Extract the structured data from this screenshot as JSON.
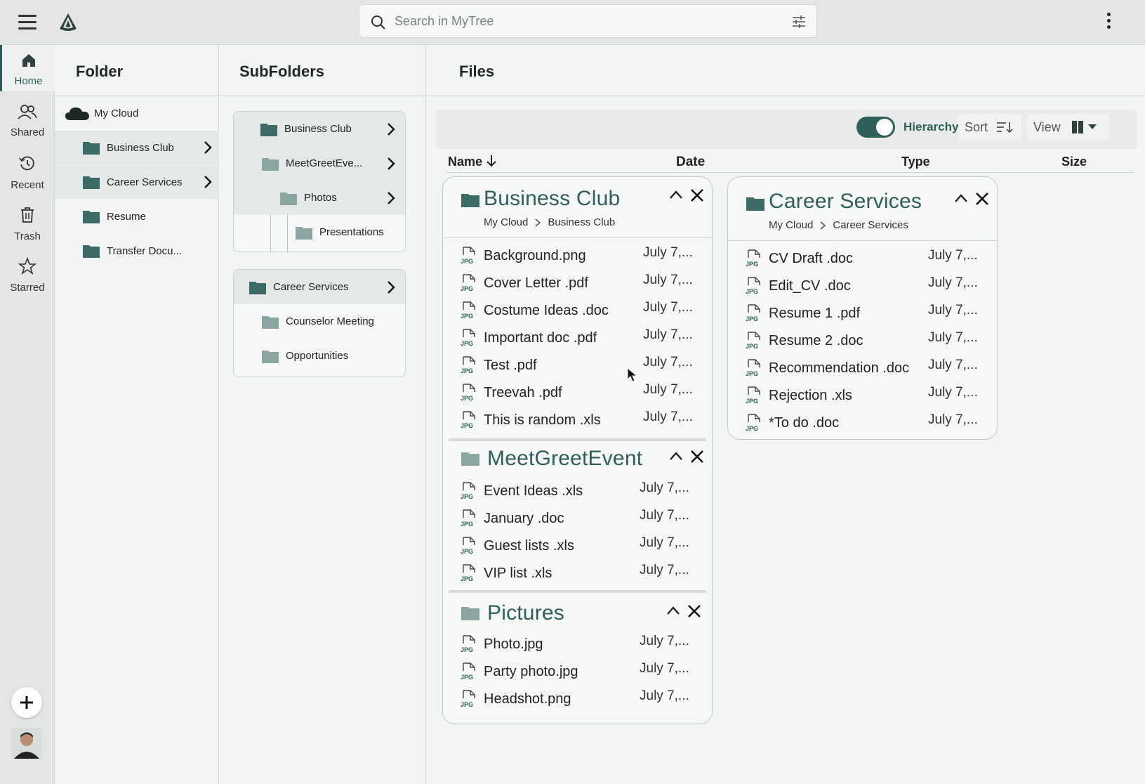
{
  "search": {
    "placeholder": "Search in MyTree"
  },
  "nav": {
    "items": [
      {
        "label": "Home",
        "icon": "home-icon"
      },
      {
        "label": "Shared",
        "icon": "shared-icon"
      },
      {
        "label": "Recent",
        "icon": "recent-icon"
      },
      {
        "label": "Trash",
        "icon": "trash-icon"
      },
      {
        "label": "Starred",
        "icon": "star-icon"
      }
    ]
  },
  "folder_col": {
    "title": "Folder",
    "root": "My Cloud",
    "items": [
      "Business Club",
      "Career Services",
      "Resume",
      "Transfer Docu..."
    ]
  },
  "sub_col": {
    "title": "SubFolders",
    "card1": [
      "Business Club",
      "MeetGreetEve...",
      "Photos",
      "Presentations"
    ],
    "card2": [
      "Career Services",
      "Counselor Meeting",
      "Opportunities"
    ]
  },
  "files_col": {
    "title": "Files",
    "toolbar": {
      "hierarchy": "Hierarchy",
      "sort": "Sort",
      "view": "View",
      "hierarchy_on": true
    },
    "headers": {
      "name": "Name",
      "date": "Date",
      "type": "Type",
      "size": "Size"
    }
  },
  "groups": {
    "business": {
      "title": "Business Club",
      "crumb_root": "My Cloud",
      "crumb_leaf": "Business Club",
      "files": [
        {
          "name": "Background.png",
          "date": "July 7,..."
        },
        {
          "name": "Cover Letter .pdf",
          "date": "July 7,..."
        },
        {
          "name": "Costume Ideas .doc",
          "date": "July 7,..."
        },
        {
          "name": "Important doc .pdf",
          "date": "July 7,..."
        },
        {
          "name": "Test .pdf",
          "date": "July 7,..."
        },
        {
          "name": "Treevah .pdf",
          "date": "July 7,..."
        },
        {
          "name": "This is random .xls",
          "date": "July 7,..."
        }
      ]
    },
    "meetgreet": {
      "title": "MeetGreetEvent",
      "files": [
        {
          "name": "Event Ideas .xls",
          "date": "July 7,..."
        },
        {
          "name": "January .doc",
          "date": "July 7,..."
        },
        {
          "name": "Guest lists .xls",
          "date": "July 7,..."
        },
        {
          "name": "VIP list .xls",
          "date": "July 7,..."
        }
      ]
    },
    "pictures": {
      "title": "Pictures",
      "files": [
        {
          "name": "Photo.jpg",
          "date": "July 7,..."
        },
        {
          "name": "Party photo.jpg",
          "date": "July 7,..."
        },
        {
          "name": "Headshot.png",
          "date": "July 7,..."
        }
      ]
    },
    "career": {
      "title": "Career Services",
      "crumb_root": "My Cloud",
      "crumb_leaf": "Career Services",
      "files": [
        {
          "name": "CV Draft .doc",
          "date": "July 7,..."
        },
        {
          "name": "Edit_CV .doc",
          "date": "July 7,..."
        },
        {
          "name": "Resume 1 .pdf",
          "date": "July 7,..."
        },
        {
          "name": "Resume 2 .doc",
          "date": "July 7,..."
        },
        {
          "name": "Recommendation .doc",
          "date": "July 7,..."
        },
        {
          "name": "Rejection .xls",
          "date": "July 7,..."
        },
        {
          "name": "*To do .doc",
          "date": "July 7,..."
        }
      ]
    }
  },
  "colors": {
    "accent": "#2f5f5b",
    "folder": "#3c6a66",
    "folder_light": "#8aa5a2"
  }
}
